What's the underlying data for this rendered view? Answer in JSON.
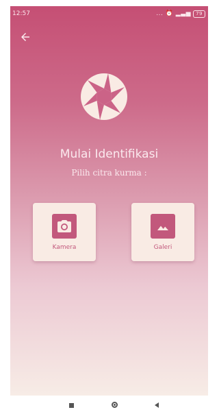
{
  "status_bar": {
    "time": "12:57",
    "indicators": "... ⏰ ▂▃▅ ",
    "battery": "79"
  },
  "icons": {
    "back": "arrow-left-icon",
    "logo": "aperture-icon",
    "camera": "camera-icon",
    "gallery": "image-icon"
  },
  "main": {
    "title": "Mulai Identifikasi",
    "subtitle": "Pilih citra kurma :"
  },
  "options": {
    "camera_label": "Kamera",
    "gallery_label": "Galeri"
  },
  "colors": {
    "accent": "#c2587c",
    "gradient_top": "#c54f74",
    "gradient_bottom": "#f7ece6",
    "card_bg": "#f9ebe4",
    "text_light": "#fbe9ee"
  },
  "nav_bar": {
    "items": [
      "recents-square-icon",
      "home-circle-icon",
      "back-triangle-icon"
    ]
  }
}
